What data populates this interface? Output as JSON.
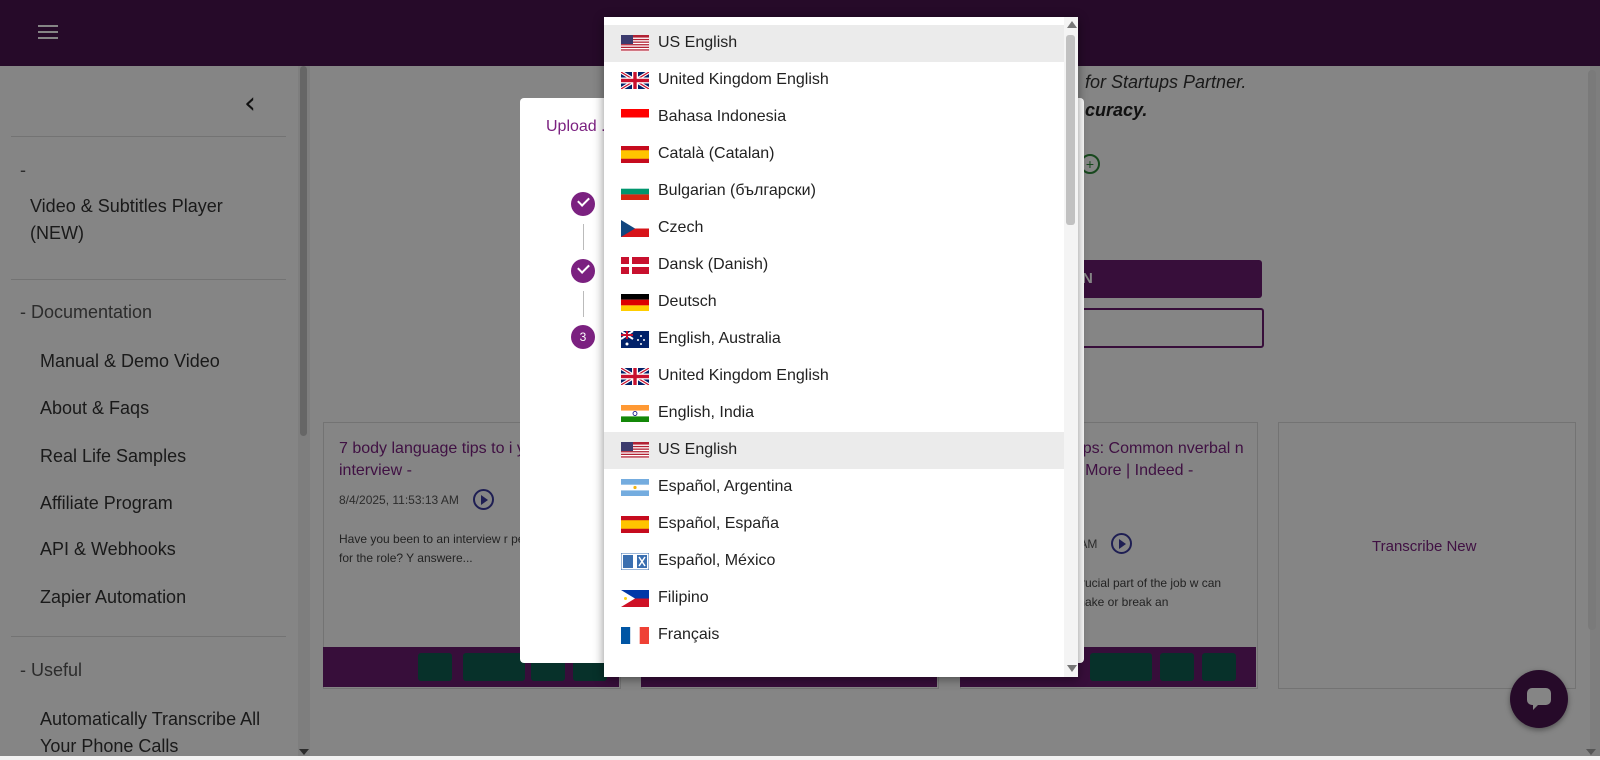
{
  "sidebar": {
    "section1": "-",
    "item_video": "Video & Subtitles Player (NEW)",
    "section_docs": "- Documentation",
    "docs_items": [
      "Manual & Demo Video",
      "About & Faqs",
      "Real Life Samples",
      "Affiliate Program",
      "API & Webhooks",
      "Zapier Automation"
    ],
    "section_useful": "- Useful",
    "useful_item": "Automatically Transcribe All Your Phone Calls"
  },
  "main": {
    "promo_line1": "for Startups Partner.",
    "promo_line2": "curacy.",
    "button_fill_label": "N",
    "cards": [
      {
        "title": "7 body language tips to i your next job interview -",
        "date": "8/4/2025, 11:53:13 AM",
        "desc": "Have you been to an interview r perfectly qualified for the role? Y answere..."
      },
      {
        "title": "Tips: Common nverbal n & More | Indeed -",
        "date": "7 AM",
        "desc": "crucial part of the job w can make or break an"
      }
    ],
    "transcribe_new": "Transcribe New"
  },
  "dialog": {
    "title": "Upload .",
    "step3": "3"
  },
  "dropdown": {
    "options": [
      {
        "label": "US English",
        "flag": "us",
        "selected": true
      },
      {
        "label": "United Kingdom English",
        "flag": "uk",
        "selected": false
      },
      {
        "label": "Bahasa Indonesia",
        "flag": "id",
        "selected": false
      },
      {
        "label": "Català (Catalan)",
        "flag": "es",
        "selected": false
      },
      {
        "label": "Bulgarian (български)",
        "flag": "bg",
        "selected": false
      },
      {
        "label": "Czech",
        "flag": "cz",
        "selected": false
      },
      {
        "label": "Dansk (Danish)",
        "flag": "dk",
        "selected": false
      },
      {
        "label": "Deutsch",
        "flag": "de",
        "selected": false
      },
      {
        "label": "English, Australia",
        "flag": "au",
        "selected": false
      },
      {
        "label": "United Kingdom English",
        "flag": "uk",
        "selected": false
      },
      {
        "label": "English, India",
        "flag": "in",
        "selected": false
      },
      {
        "label": "US English",
        "flag": "us",
        "selected": true
      },
      {
        "label": "Español, Argentina",
        "flag": "ar",
        "selected": false
      },
      {
        "label": "Español, España",
        "flag": "es",
        "selected": false
      },
      {
        "label": "Español, México",
        "flag": "mx",
        "selected": false
      },
      {
        "label": "Filipino",
        "flag": "ph",
        "selected": false
      },
      {
        "label": "Français",
        "flag": "fr",
        "selected": false
      }
    ]
  },
  "colors": {
    "brand": "#4a1450",
    "accent": "#7b2180",
    "selected_row": "#ebebeb"
  }
}
